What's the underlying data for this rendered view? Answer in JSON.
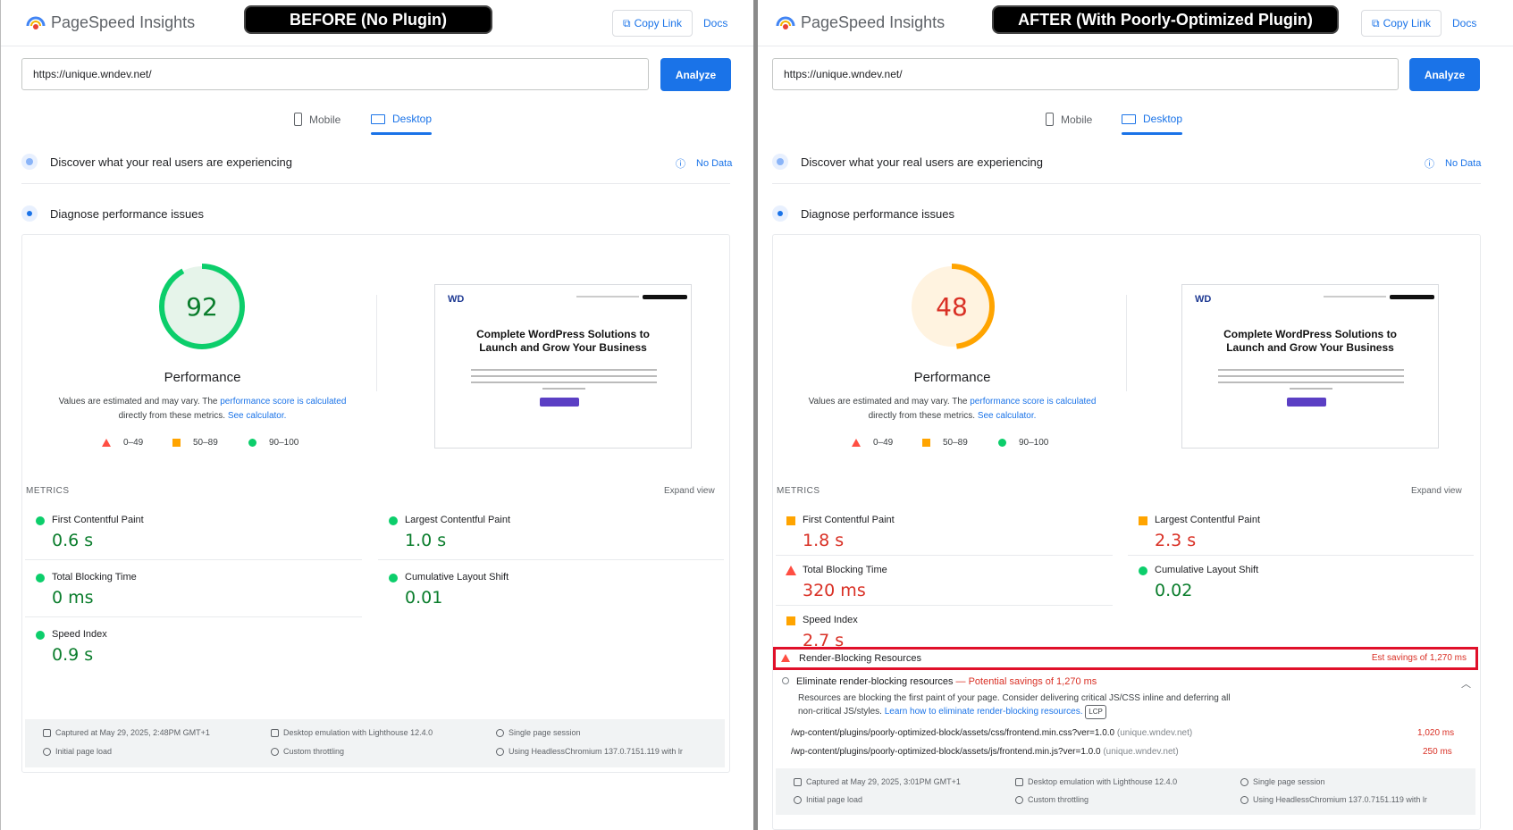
{
  "colors": {
    "accent": "#1a73e8",
    "pass": "#0cce6b",
    "average": "#ffa400",
    "fail": "#ff4e42",
    "highlight_border": "#e0102a"
  },
  "common": {
    "app_title": "PageSpeed Insights",
    "copy_link": "Copy Link",
    "docs": "Docs",
    "url": "https://unique.wndev.net/",
    "analyze": "Analyze",
    "tab_mobile": "Mobile",
    "tab_desktop": "Desktop",
    "discover": "Discover what your real users are experiencing",
    "no_data": "No Data",
    "diagnose": "Diagnose performance issues",
    "performance": "Performance",
    "note_prefix": "Values are estimated and may vary. The ",
    "note_link1": "performance score is calculated",
    "note_mid": "directly from these metrics. ",
    "note_link2": "See calculator.",
    "legend_fail": "0–49",
    "legend_avg": "50–89",
    "legend_pass": "90–100",
    "metrics_label": "METRICS",
    "expand_view": "Expand view",
    "thumb_logo": "WD",
    "thumb_heading_1": "Complete WordPress Solutions to",
    "thumb_heading_2": "Launch and Grow Your Business",
    "m_fcp": "First Contentful Paint",
    "m_lcp": "Largest Contentful Paint",
    "m_tbt": "Total Blocking Time",
    "m_cls": "Cumulative Layout Shift",
    "m_si": "Speed Index",
    "f_desktop": "Desktop emulation with Lighthouse 12.4.0",
    "f_session": "Single page session",
    "f_initial": "Initial page load",
    "f_throttle": "Custom throttling",
    "f_browser": "Using HeadlessChromium 137.0.7151.119 with lr"
  },
  "before": {
    "label": "BEFORE (No Plugin)",
    "score": "92",
    "fcp": "0.6 s",
    "lcp": "1.0 s",
    "tbt": "0 ms",
    "cls": "0.01",
    "si": "0.9 s",
    "captured": "Captured at May 29, 2025, 2:48PM GMT+1"
  },
  "after": {
    "label": "AFTER (With Poorly-Optimized Plugin)",
    "score": "48",
    "fcp": "1.8 s",
    "lcp": "2.3 s",
    "tbt": "320 ms",
    "cls": "0.02",
    "si": "2.7 s",
    "captured": "Captured at May 29, 2025, 3:01PM GMT+1",
    "rb_title": "Render-Blocking Resources",
    "rb_savings": "Est savings of 1,270 ms",
    "elim_title": "Eliminate render-blocking resources",
    "elim_savings": "— Potential savings of 1,270 ms",
    "elim_desc_1": "Resources are blocking the first paint of your page. Consider delivering critical JS/CSS inline and deferring all",
    "elim_desc_2": "non-critical JS/styles. ",
    "elim_link": "Learn how to eliminate render-blocking resources.",
    "lcp_tag": "LCP",
    "resources": [
      {
        "path": "/wp-content/plugins/poorly-optimized-block/assets/css/frontend.min.css?ver=1.0.0",
        "host": "(unique.wndev.net)",
        "ms": "1,020 ms"
      },
      {
        "path": "/wp-content/plugins/poorly-optimized-block/assets/js/frontend.min.js?ver=1.0.0",
        "host": "(unique.wndev.net)",
        "ms": "250 ms"
      }
    ]
  }
}
